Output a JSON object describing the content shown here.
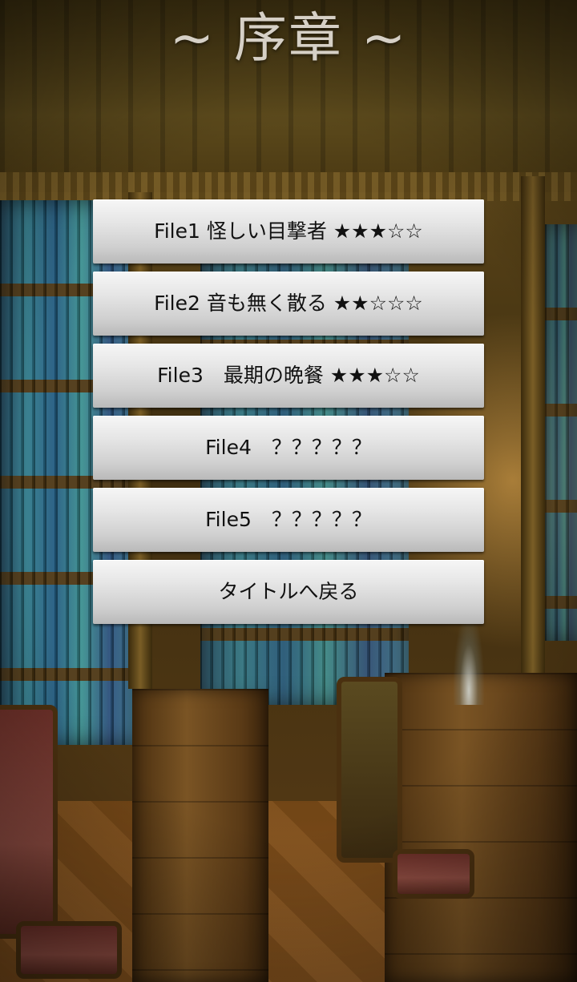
{
  "screen": {
    "title": "~ 序章 ~"
  },
  "menu": {
    "items": [
      {
        "label": "File1 怪しい目撃者 ★★★☆☆"
      },
      {
        "label": "File2 音も無く散る ★★☆☆☆"
      },
      {
        "label": "File3　最期の晩餐 ★★★☆☆"
      },
      {
        "label": "File4　？？？？？"
      },
      {
        "label": "File5　？？？？？"
      },
      {
        "label": "タイトルへ戻る"
      }
    ]
  },
  "colors": {
    "title_text": "#d6d0c6",
    "button_top": "#f6f6f6",
    "button_bottom": "#b9b9b9",
    "button_text": "#111111"
  },
  "background": {
    "scene": "library-room",
    "icon": "library-background-image"
  }
}
